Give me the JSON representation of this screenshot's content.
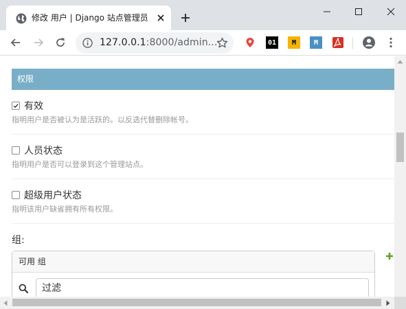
{
  "browser": {
    "tab": {
      "title": "修改 用户 | Django 站点管理员",
      "favicon": "globe-icon",
      "close_icon": "close-icon"
    },
    "new_tab_icon": "plus-icon",
    "window_controls": [
      "minimize-icon",
      "maximize-icon",
      "close-icon"
    ],
    "nav": [
      "back-arrow-icon",
      "forward-arrow-icon",
      "reload-icon"
    ],
    "address": {
      "host": "127.0.0.1",
      "path": ":8000/admin..."
    },
    "extensions": [
      {
        "name": "location-pin-icon",
        "color": "#e8453c"
      },
      {
        "name": "01-extension-icon",
        "label": "01",
        "color": "#000000"
      },
      {
        "name": "m-extension-yellow-icon",
        "label": "M",
        "color": "#f4b400"
      },
      {
        "name": "m-extension-blue-icon",
        "label": "M",
        "color": "#4a8fc4"
      },
      {
        "name": "acrobat-pdf-icon",
        "color": "#d93025"
      }
    ],
    "profile_icon": "account-circle-icon",
    "menu_icon": "more-vert-icon"
  },
  "page": {
    "fieldset_title": "权限",
    "header_color": "#79aec8",
    "permissions": [
      {
        "label": "有效",
        "checked": true,
        "help": "指明用户是否被认为是活跃的。以反选代替删除帐号。"
      },
      {
        "label": "人员状态",
        "checked": false,
        "help": "指明用户是否可以登录到这个管理站点。"
      },
      {
        "label": "超级用户状态",
        "checked": false,
        "help": "指明该用户缺省拥有所有权限。"
      }
    ],
    "groups": {
      "label": "组:",
      "available_title": "可用 组",
      "filter_placeholder": "过滤",
      "add_color": "#5fa225"
    }
  }
}
